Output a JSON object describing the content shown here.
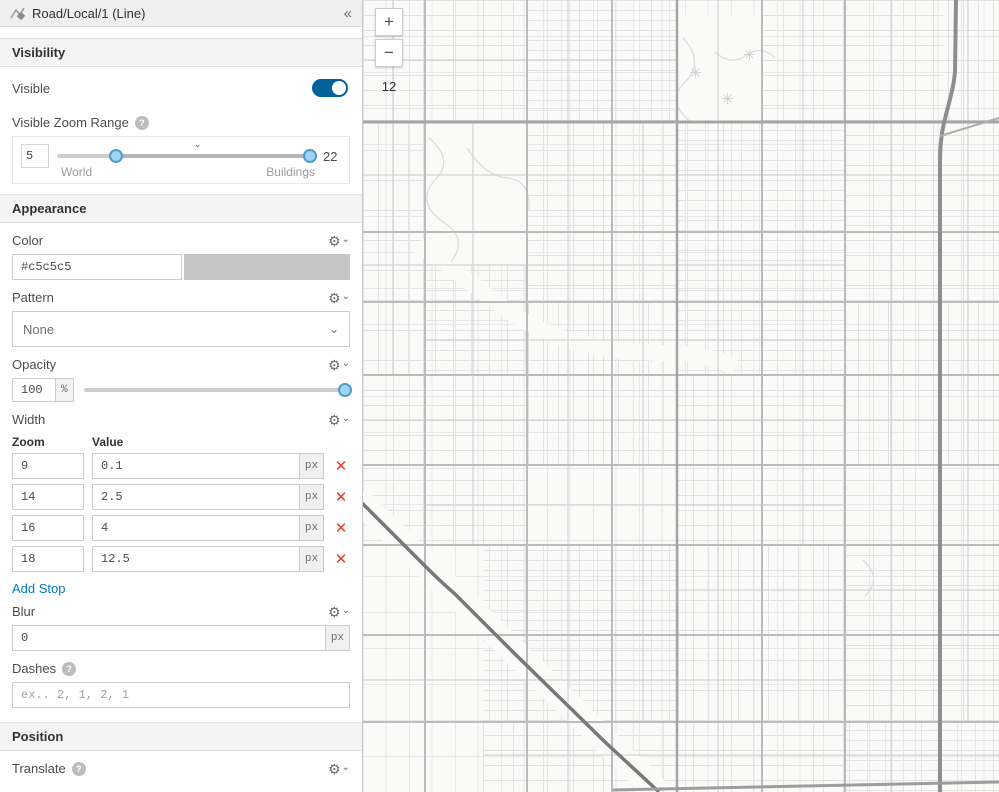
{
  "panel": {
    "title": "Road/Local/1 (Line)",
    "collapse_icon": "«",
    "sections": {
      "visibility": {
        "label": "Visibility",
        "visible_label": "Visible",
        "visible_on": true,
        "zoom_range": {
          "label": "Visible Zoom Range",
          "help": "?",
          "min_value": "5",
          "max_value": "22",
          "min_label": "World",
          "max_label": "Buildings",
          "current_zoom_marker": "⌄"
        }
      },
      "appearance": {
        "label": "Appearance",
        "color": {
          "label": "Color",
          "value": "#c5c5c5"
        },
        "pattern": {
          "label": "Pattern",
          "value": "None"
        },
        "opacity": {
          "label": "Opacity",
          "value": "100",
          "unit": "%"
        },
        "width": {
          "label": "Width",
          "columns": {
            "zoom": "Zoom",
            "value": "Value"
          },
          "unit": "px",
          "delete_icon": "✕",
          "stops": [
            {
              "zoom": "9",
              "value": "0.1"
            },
            {
              "zoom": "14",
              "value": "2.5"
            },
            {
              "zoom": "16",
              "value": "4"
            },
            {
              "zoom": "18",
              "value": "12.5"
            }
          ],
          "add_stop_label": "Add Stop"
        },
        "blur": {
          "label": "Blur",
          "value": "0",
          "unit": "px"
        },
        "dashes": {
          "label": "Dashes",
          "help": "?",
          "placeholder": "ex.. 2, 1, 2, 1"
        }
      },
      "position": {
        "label": "Position",
        "translate": {
          "label": "Translate",
          "help": "?"
        }
      }
    }
  },
  "map": {
    "zoom_in": "+",
    "zoom_out": "−",
    "zoom_level": "12"
  },
  "colors": {
    "accent_blue": "#0079c1",
    "toggle_on": "#00619b",
    "swatch": "#c5c5c5",
    "delete_red": "#e23b2e"
  }
}
